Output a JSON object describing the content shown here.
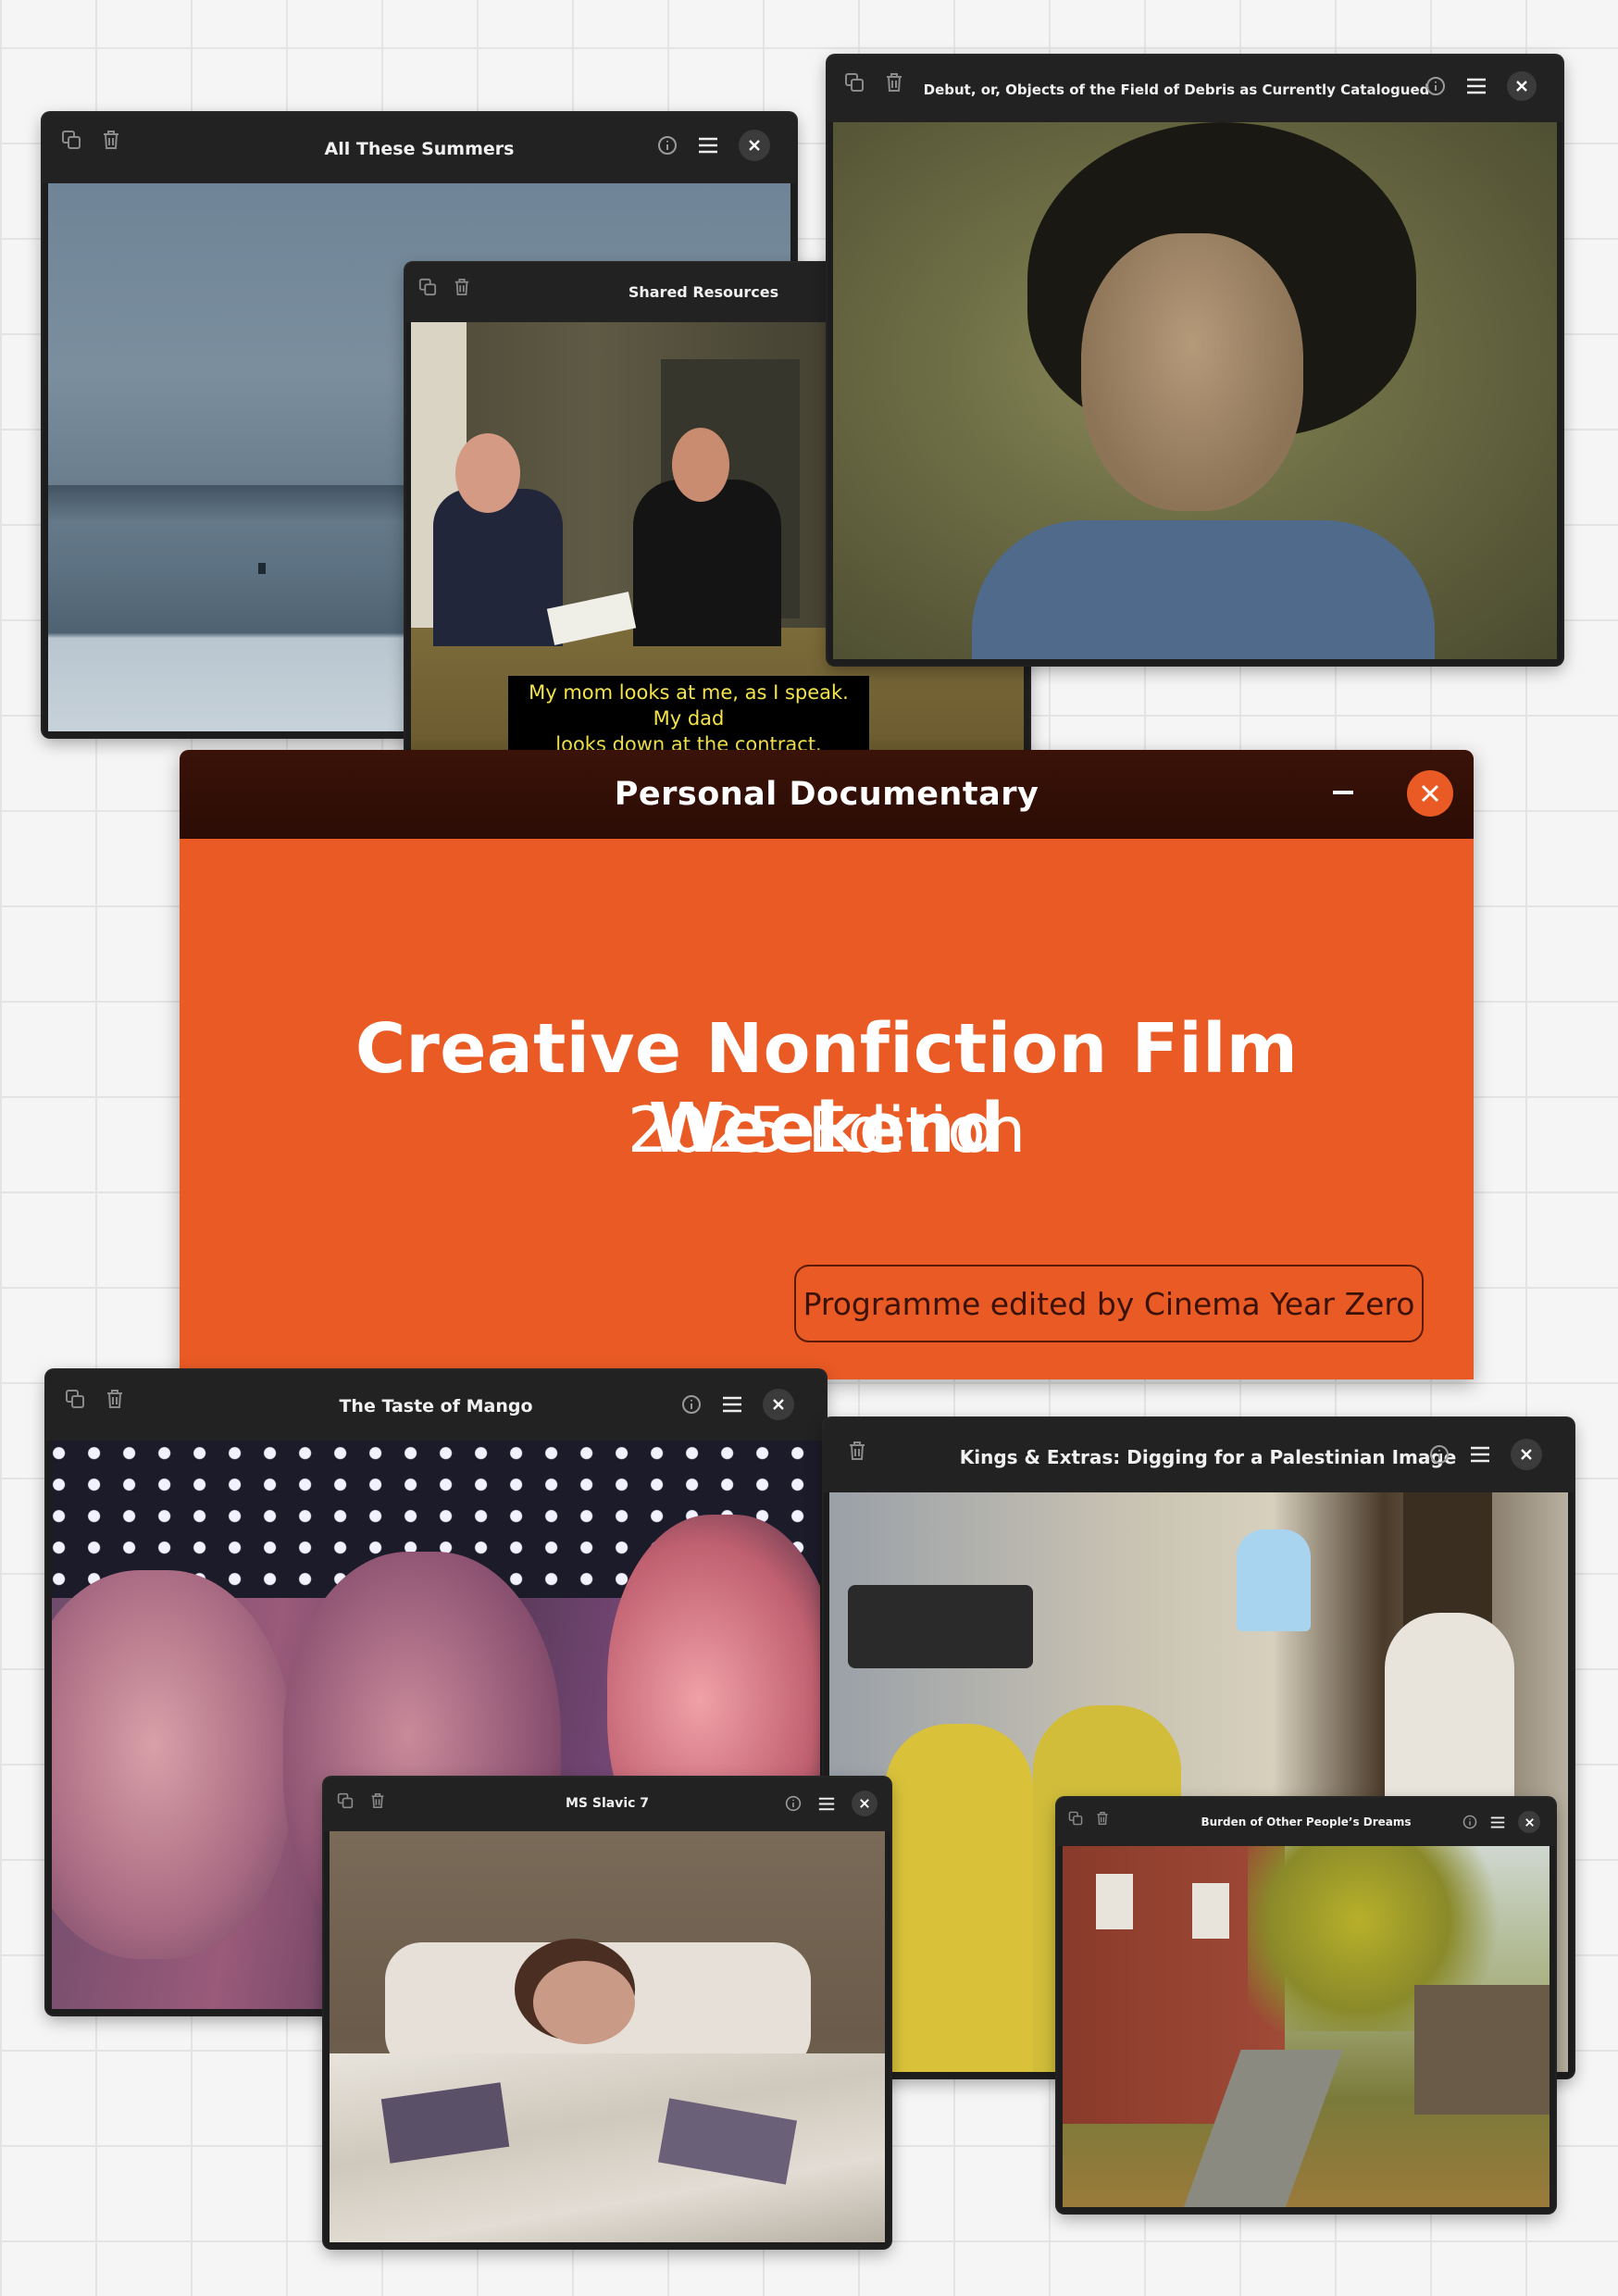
{
  "windows": {
    "all_these_summers": {
      "title": "All These Summers"
    },
    "shared_resources": {
      "title": "Shared Resources",
      "subtitle_line1": "My mom looks at me, as I speak. My dad",
      "subtitle_line2": "looks down at the contract."
    },
    "debut": {
      "title": "Debut, or, Objects of the Field of Debris as Currently Catalogued"
    },
    "taste_of_mango": {
      "title": "The Taste of Mango"
    },
    "kings_extras": {
      "title": "Kings & Extras: Digging for a Palestinian Image"
    },
    "ms_slavic": {
      "title": "MS Slavic 7"
    },
    "burden": {
      "title": "Burden of Other People’s Dreams"
    }
  },
  "main": {
    "window_title": "Personal Documentary",
    "headline": "Creative Nonfiction Film Weekend",
    "edition": "2025 Edition",
    "credit_button": "Programme edited by Cinema Year Zero"
  },
  "colors": {
    "accent": "#e95a25",
    "main_titlebar": "#2b0c05",
    "window_chrome": "#1d1d1d",
    "subtitle_text": "#f4e34a"
  },
  "icons": [
    "copy-icon",
    "trash-icon",
    "info-icon",
    "menu-icon",
    "close-icon",
    "minimize-icon"
  ]
}
